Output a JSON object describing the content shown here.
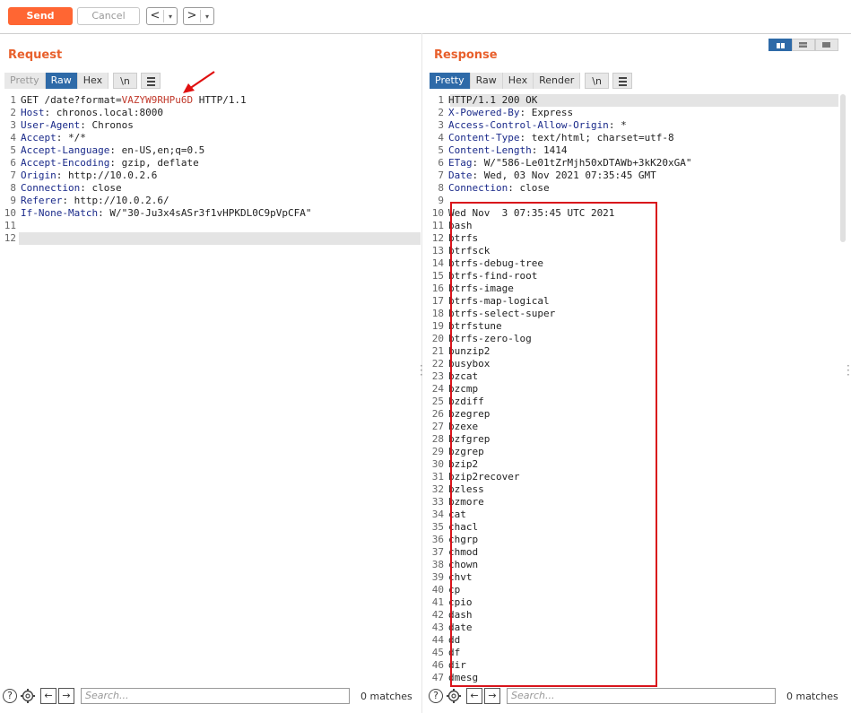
{
  "toolbar": {
    "send_label": "Send",
    "cancel_label": "Cancel",
    "back_label": "<",
    "forward_label": ">",
    "dropdown_label": "▾"
  },
  "request": {
    "title": "Request",
    "tabs": [
      "Pretty",
      "Raw",
      "Hex",
      "\\n"
    ],
    "active_tab": "Raw",
    "line1": {
      "method_path": "GET /date?format=",
      "highlight": "VAZYW9RHPu6D",
      "protocol": " HTTP/1.1"
    },
    "headers": [
      {
        "name": "Host",
        "value": "chronos.local:8000"
      },
      {
        "name": "User-Agent",
        "value": "Chronos"
      },
      {
        "name": "Accept",
        "value": "*/*"
      },
      {
        "name": "Accept-Language",
        "value": "en-US,en;q=0.5"
      },
      {
        "name": "Accept-Encoding",
        "value": "gzip, deflate"
      },
      {
        "name": "Origin",
        "value": "http://10.0.2.6"
      },
      {
        "name": "Connection",
        "value": "close"
      },
      {
        "name": "Referer",
        "value": "http://10.0.2.6/"
      },
      {
        "name": "If-None-Match",
        "value": "W/\"30-Ju3x4sASr3f1vHPKDL0C9pVpCFA\""
      }
    ],
    "search_placeholder": "Search...",
    "matches": "0 matches"
  },
  "response": {
    "title": "Response",
    "tabs": [
      "Pretty",
      "Raw",
      "Hex",
      "Render",
      "\\n"
    ],
    "active_tab": "Pretty",
    "status_line": "HTTP/1.1 200 OK",
    "headers": [
      {
        "name": "X-Powered-By",
        "value": "Express"
      },
      {
        "name": "Access-Control-Allow-Origin",
        "value": "*"
      },
      {
        "name": "Content-Type",
        "value": "text/html; charset=utf-8"
      },
      {
        "name": "Content-Length",
        "value": "1414"
      },
      {
        "name": "ETag",
        "value": "W/\"586-Le01tZrMjh50xDTAWb+3kK20xGA\""
      },
      {
        "name": "Date",
        "value": "Wed, 03 Nov 2021 07:35:45 GMT"
      },
      {
        "name": "Connection",
        "value": "close"
      }
    ],
    "body_lines": [
      "Wed Nov  3 07:35:45 UTC 2021",
      "bash",
      "btrfs",
      "btrfsck",
      "btrfs-debug-tree",
      "btrfs-find-root",
      "btrfs-image",
      "btrfs-map-logical",
      "btrfs-select-super",
      "btrfstune",
      "btrfs-zero-log",
      "bunzip2",
      "busybox",
      "bzcat",
      "bzcmp",
      "bzdiff",
      "bzegrep",
      "bzexe",
      "bzfgrep",
      "bzgrep",
      "bzip2",
      "bzip2recover",
      "bzless",
      "bzmore",
      "cat",
      "chacl",
      "chgrp",
      "chmod",
      "chown",
      "chvt",
      "cp",
      "cpio",
      "dash",
      "date",
      "dd",
      "df",
      "dir",
      "dmesg"
    ],
    "search_placeholder": "Search...",
    "matches": "0 matches"
  },
  "colors": {
    "accent": "#ff6633",
    "tab_active": "#2e6aa8",
    "highlight_box": "#d9141b",
    "arrow": "#e01010"
  }
}
